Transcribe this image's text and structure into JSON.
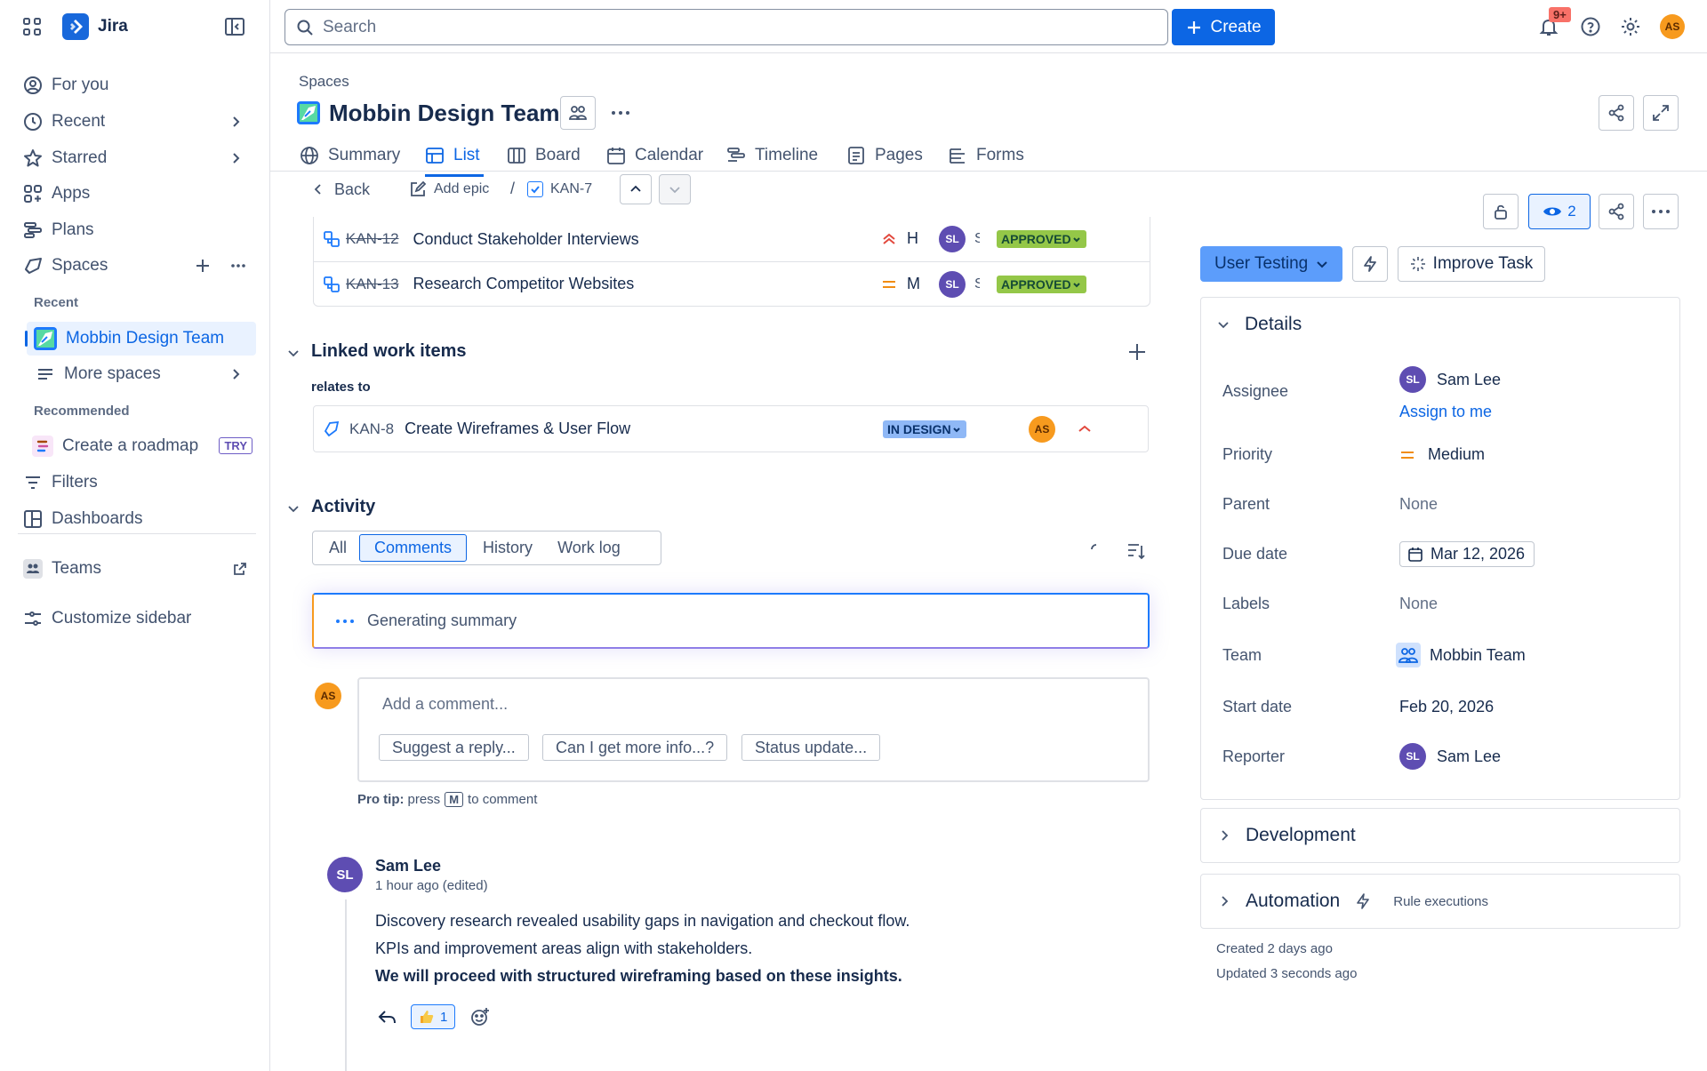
{
  "app": {
    "name": "Jira"
  },
  "sidebar": {
    "for_you": "For you",
    "recent": "Recent",
    "starred": "Starred",
    "apps": "Apps",
    "plans": "Plans",
    "spaces": "Spaces",
    "recent_label": "Recent",
    "active_space": "Mobbin Design Team",
    "more_spaces": "More spaces",
    "recommended_label": "Recommended",
    "create_roadmap": "Create a roadmap",
    "try_badge": "TRY",
    "filters": "Filters",
    "dashboards": "Dashboards",
    "teams": "Teams",
    "customize": "Customize sidebar"
  },
  "topbar": {
    "search_placeholder": "Search",
    "create_label": "Create",
    "notif_badge": "9+",
    "user_initials": "AS"
  },
  "space": {
    "breadcrumb": "Spaces",
    "title": "Mobbin Design Team",
    "tabs": [
      "Summary",
      "List",
      "Board",
      "Calendar",
      "Timeline",
      "Pages",
      "Forms"
    ]
  },
  "issue_nav": {
    "back": "Back",
    "add_epic": "Add epic",
    "separator": "/",
    "key": "KAN-7"
  },
  "child_items": [
    {
      "key": "KAN-12",
      "title": "Conduct Stakeholder Interviews",
      "priority": "H",
      "assignee": "SL",
      "status": "APPROVED"
    },
    {
      "key": "KAN-13",
      "title": "Research Competitor Websites",
      "priority": "M",
      "assignee": "SL",
      "status": "APPROVED"
    }
  ],
  "linked": {
    "heading": "Linked work items",
    "relation": "relates to",
    "item": {
      "key": "KAN-8",
      "title": "Create Wireframes & User Flow",
      "status": "IN DESIGN",
      "assignee": "AS"
    }
  },
  "activity": {
    "heading": "Activity",
    "tabs": [
      "All",
      "Comments",
      "History",
      "Work log"
    ],
    "summary_status": "Generating summary",
    "comment_placeholder": "Add a comment...",
    "suggestions": [
      "Suggest a reply...",
      "Can I get more info...?",
      "Status update..."
    ],
    "pro_tip_label": "Pro tip:",
    "pro_tip_press": "press",
    "pro_tip_key": "M",
    "pro_tip_rest": "to comment",
    "user_initials": "AS"
  },
  "comment": {
    "author": "Sam Lee",
    "initials": "SL",
    "time": "1 hour ago",
    "edited": "(edited)",
    "line1": "Discovery research revealed usability gaps in navigation and checkout flow.",
    "line2": "KPIs and improvement areas align with stakeholders.",
    "line3": "We will proceed with structured wireframing based on these insights.",
    "reaction_count": "1"
  },
  "right_panel": {
    "watch_count": "2",
    "status_button": "User Testing",
    "improve_task": "Improve Task",
    "details_heading": "Details",
    "assignee_label": "Assignee",
    "assignee": "Sam Lee",
    "assignee_initials": "SL",
    "assign_to_me": "Assign to me",
    "priority_label": "Priority",
    "priority": "Medium",
    "parent_label": "Parent",
    "parent": "None",
    "due_label": "Due date",
    "due": "Mar 12, 2026",
    "labels_label": "Labels",
    "labels": "None",
    "team_label": "Team",
    "team": "Mobbin Team",
    "start_label": "Start date",
    "start": "Feb 20, 2026",
    "reporter_label": "Reporter",
    "reporter": "Sam Lee",
    "reporter_initials": "SL",
    "development": "Development",
    "automation": "Automation",
    "rule_executions": "Rule executions",
    "created": "Created 2 days ago",
    "updated": "Updated 3 seconds ago"
  },
  "colors": {
    "brand": "#0c66e4",
    "approved": "#94c748",
    "in_design": "#8fb8f6",
    "priority_high": "#e2483d",
    "priority_medium": "#f18d13"
  }
}
